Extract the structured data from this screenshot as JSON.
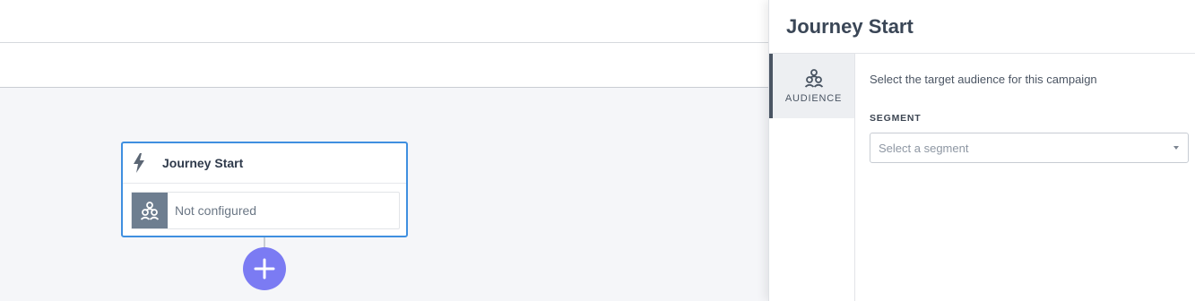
{
  "canvas": {
    "node": {
      "title": "Journey Start",
      "status": "Not configured",
      "icon": "bolt-icon",
      "status_icon": "audience-icon"
    },
    "add_step_icon": "plus-icon"
  },
  "panel": {
    "title": "Journey Start",
    "tabs": [
      {
        "label": "AUDIENCE",
        "icon": "audience-icon",
        "active": true
      }
    ],
    "description": "Select the target audience for this campaign",
    "segment": {
      "label": "SEGMENT",
      "placeholder": "Select a segment"
    }
  },
  "colors": {
    "accent": "#3f8fe0",
    "add_button": "#7b7bf3",
    "node_icon_bg": "#6e7e90"
  }
}
